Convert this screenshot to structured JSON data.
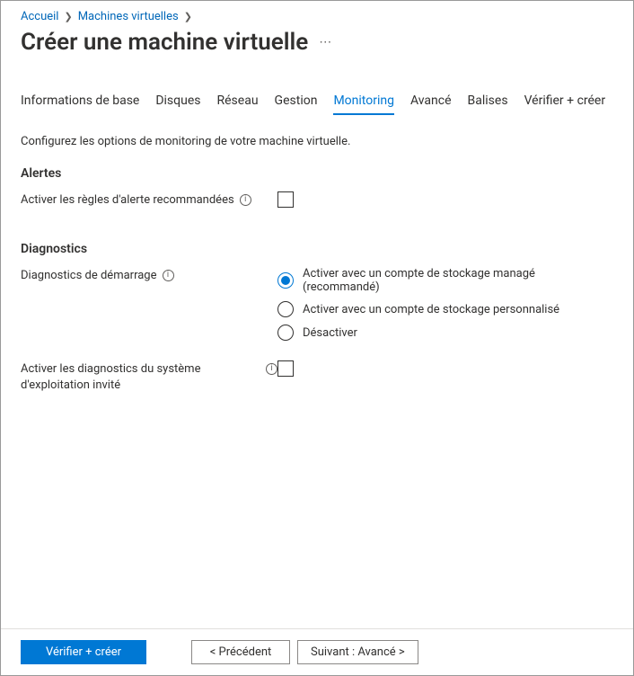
{
  "breadcrumb": {
    "items": [
      "Accueil",
      "Machines virtuelles"
    ]
  },
  "page": {
    "title": "Créer une machine virtuelle"
  },
  "tabs": {
    "items": [
      {
        "label": "Informations de base"
      },
      {
        "label": "Disques"
      },
      {
        "label": "Réseau"
      },
      {
        "label": "Gestion"
      },
      {
        "label": "Monitoring"
      },
      {
        "label": "Avancé"
      },
      {
        "label": "Balises"
      },
      {
        "label": "Vérifier + créer"
      }
    ],
    "activeIndex": 4
  },
  "intro": "Configurez les options de monitoring de votre machine virtuelle.",
  "sections": {
    "alerts": {
      "heading": "Alertes",
      "enable_recommended_label": "Activer les règles d'alerte recommandées",
      "enable_recommended_checked": false
    },
    "diagnostics": {
      "heading": "Diagnostics",
      "boot_diag_label": "Diagnostics de démarrage",
      "boot_diag_options": [
        {
          "label": "Activer avec un compte de stockage managé (recommandé)",
          "selected": true
        },
        {
          "label": "Activer avec un compte de stockage personnalisé",
          "selected": false
        },
        {
          "label": "Désactiver",
          "selected": false
        }
      ],
      "guest_diag_label": "Activer les diagnostics du système d'exploitation invité",
      "guest_diag_checked": false
    }
  },
  "footer": {
    "review_create": "Vérifier + créer",
    "previous": "<  Précédent",
    "next": "Suivant : Avancé  >"
  }
}
